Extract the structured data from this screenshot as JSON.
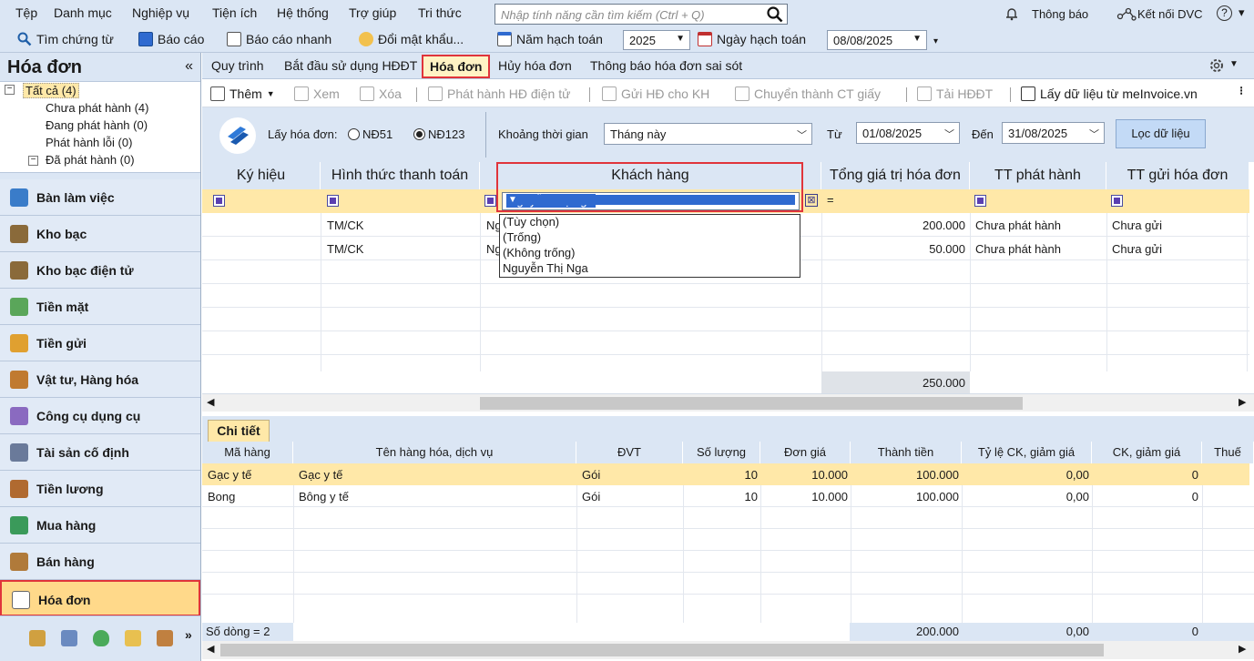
{
  "menu": {
    "items": [
      "Tệp",
      "Danh mục",
      "Nghiệp vụ",
      "Tiện ích",
      "Hệ thống",
      "Trợ giúp",
      "Tri thức"
    ],
    "search_placeholder": "Nhập tính năng cần tìm kiếm (Ctrl + Q)",
    "notify_label": "Thông báo",
    "connect_label": "Kết nối DVC",
    "help_label": "?"
  },
  "toolbar": {
    "find_voucher": "Tìm chứng từ",
    "report": "Báo cáo",
    "quick_report": "Báo cáo nhanh",
    "change_password": "Đổi mật khẩu...",
    "fiscal_year_label": "Năm hạch toán",
    "fiscal_year_value": "2025",
    "posting_date_label": "Ngày hạch toán",
    "posting_date_value": "08/08/2025"
  },
  "sidebar": {
    "title": "Hóa đơn",
    "tree": {
      "root": "Tất cả (4)",
      "children": [
        "Chưa phát hành (4)",
        "Đang phát hành (0)",
        "Phát hành lỗi (0)",
        "Đã phát hành (0)"
      ]
    },
    "nav": [
      "Bàn làm việc",
      "Kho bạc",
      "Kho bạc điện tử",
      "Tiền mặt",
      "Tiền gửi",
      "Vật tư, Hàng hóa",
      "Công cụ dụng cụ",
      "Tài sản cố định",
      "Tiền lương",
      "Mua hàng",
      "Bán hàng",
      "Hóa đơn"
    ],
    "more_label": "»"
  },
  "tabs": [
    "Quy trình",
    "Bắt đầu sử dụng HĐĐT",
    "Hóa đơn",
    "Hủy hóa đơn",
    "Thông báo hóa đơn sai sót"
  ],
  "actions": {
    "add": "Thêm",
    "view": "Xem",
    "delete": "Xóa",
    "issue": "Phát hành HĐ điện tử",
    "send": "Gửi HĐ cho KH",
    "convert": "Chuyển thành CT giấy",
    "download": "Tải HĐĐT",
    "fetch": "Lấy dữ liệu từ meInvoice.vn"
  },
  "filter": {
    "get_invoice_label": "Lấy hóa đơn:",
    "option_nd51": "NĐ51",
    "option_nd123": "NĐ123",
    "selected": "NĐ123",
    "period_label": "Khoảng thời gian",
    "period_value": "Tháng này",
    "from_label": "Từ",
    "from_value": "01/08/2025",
    "to_label": "Đến",
    "to_value": "31/08/2025",
    "filter_button": "Lọc dữ liệu"
  },
  "grid": {
    "headers": [
      "Ký hiệu",
      "Hình thức thanh toán",
      "Khách hàng",
      "Tổng giá trị hóa đơn",
      "TT phát hành",
      "TT gửi hóa đơn"
    ],
    "filter_value": "Nguyễn Thị Nga",
    "equals_sign": "=",
    "rows": [
      {
        "payment": "TM/CK",
        "customer": "Ng",
        "total": "200.000",
        "issue_status": "Chưa phát hành",
        "send_status": "Chưa gửi"
      },
      {
        "payment": "TM/CK",
        "customer": "Ng",
        "total": "50.000",
        "issue_status": "Chưa phát hành",
        "send_status": "Chưa gửi"
      }
    ],
    "sum_total": "250.000",
    "dropdown_options": [
      "(Tùy chọn)",
      "(Trống)",
      "(Không trống)",
      "Nguyễn Thị Nga"
    ]
  },
  "detail": {
    "tab_label": "Chi tiết",
    "headers": [
      "Mã hàng",
      "Tên hàng hóa, dịch vụ",
      "ĐVT",
      "Số lượng",
      "Đơn giá",
      "Thành tiền",
      "Tỷ lệ CK, giảm giá",
      "CK, giảm giá",
      "Thuế"
    ],
    "rows": [
      {
        "code": "Gạc y tế",
        "name": "Gạc y tế",
        "unit": "Gói",
        "qty": "10",
        "price": "10.000",
        "amount": "100.000",
        "disc_rate": "0,00",
        "disc": "0"
      },
      {
        "code": "Bong",
        "name": "Bông y tế",
        "unit": "Gói",
        "qty": "10",
        "price": "10.000",
        "amount": "100.000",
        "disc_rate": "0,00",
        "disc": "0"
      }
    ],
    "row_count": "Số dòng = 2",
    "sum_amount": "200.000",
    "sum_disc_rate": "0,00",
    "sum_disc": "0"
  }
}
